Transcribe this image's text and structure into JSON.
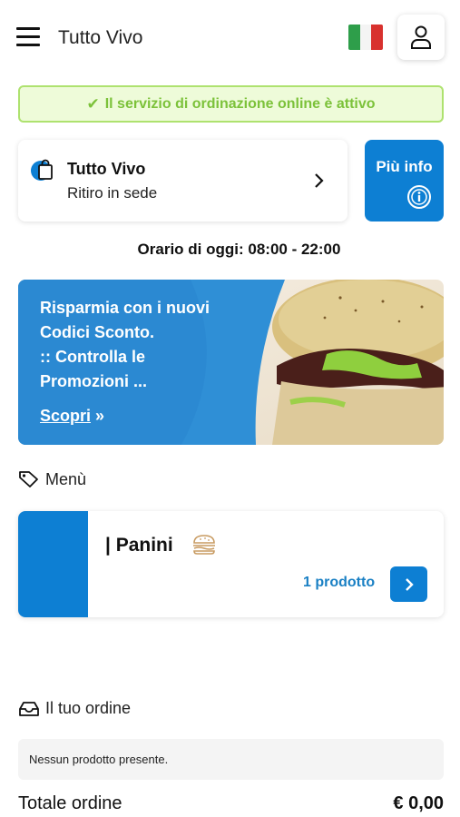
{
  "header": {
    "app_title": "Tutto Vivo",
    "menu_icon": "hamburger-menu-icon",
    "language_icon": "italian-flag-icon",
    "user_icon": "user-icon"
  },
  "status": {
    "text": "Il servizio di ordinazione online è attivo",
    "icon": "check-icon",
    "color": "#7cc23a"
  },
  "store": {
    "name": "Tutto Vivo",
    "mode": "Ritiro in sede",
    "icon": "shopping-bag-icon"
  },
  "info_button": {
    "label": "Più info",
    "icon": "info-icon"
  },
  "hours": {
    "text": "Orario di oggi: 08:00 - 22:00"
  },
  "promo": {
    "lines": [
      "Risparmia con i nuovi",
      "Codici Sconto.",
      ":: Controlla le",
      "Promozioni ..."
    ],
    "cta": "Scopri",
    "cta_icon": "double-chevron-right-icon"
  },
  "menu_section": {
    "title": "Menù",
    "icon": "tag-icon",
    "categories": [
      {
        "title": "| Panini",
        "count": "1 prodotto",
        "icon": "burger-icon"
      }
    ]
  },
  "order": {
    "title": "Il tuo ordine",
    "icon": "inbox-icon",
    "empty_text": "Nessun prodotto presente.",
    "total_label": "Totale ordine",
    "total_value": "€ 0,00"
  },
  "colors": {
    "primary": "#0d7fd3",
    "success": "#7cc23a"
  }
}
